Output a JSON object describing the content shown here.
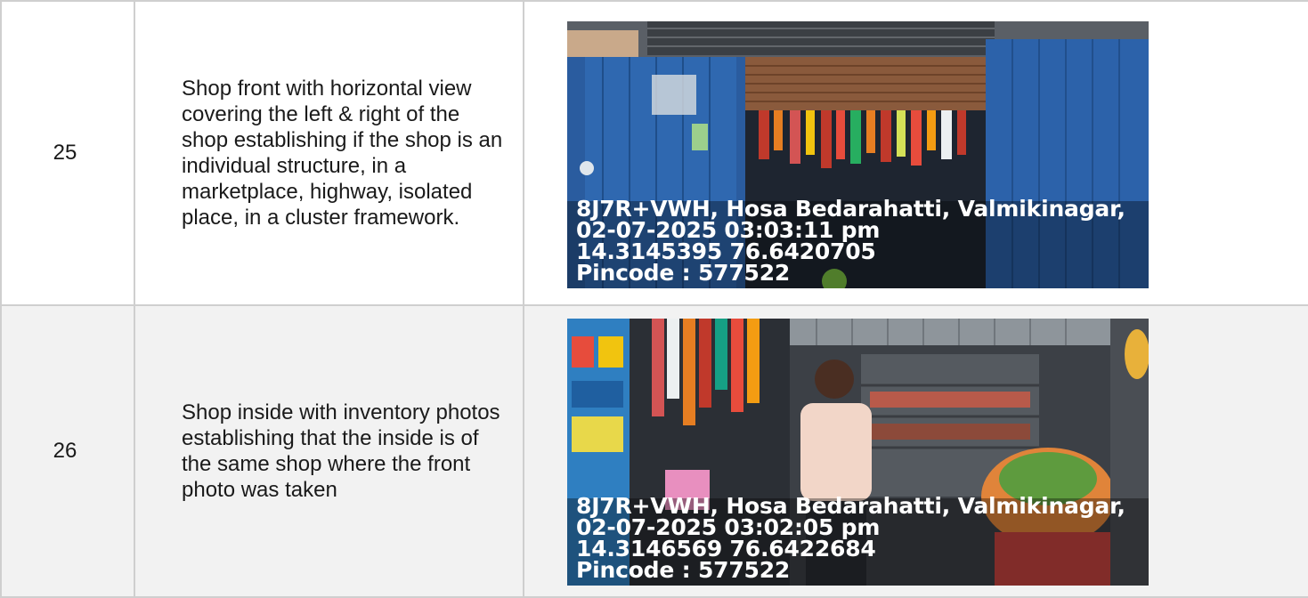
{
  "rows": [
    {
      "number": "25",
      "description": "Shop front with horizontal view covering the left & right of the shop establishing if the shop is an individual structure, in a marketplace, highway, isolated place, in a cluster framework.",
      "photo": {
        "address": "8J7R+VWH, Hosa Bedarahatti, Valmikinagar,",
        "datetime": "02-07-2025 03:03:11 pm",
        "coordinates": "14.3145395 76.6420705",
        "pincode": "Pincode : 577522"
      }
    },
    {
      "number": "26",
      "description": "Shop inside with inventory photos establishing that the inside is of the same shop where the front photo was taken",
      "photo": {
        "address": "8J7R+VWH, Hosa Bedarahatti, Valmikinagar,",
        "datetime": "02-07-2025 03:02:05 pm",
        "coordinates": "14.3146569 76.6422684",
        "pincode": "Pincode : 577522"
      }
    }
  ],
  "colors": {
    "border": "#cfcfcf",
    "row_alt_background": "#f2f2f2",
    "stamp_text": "#ffffff"
  }
}
